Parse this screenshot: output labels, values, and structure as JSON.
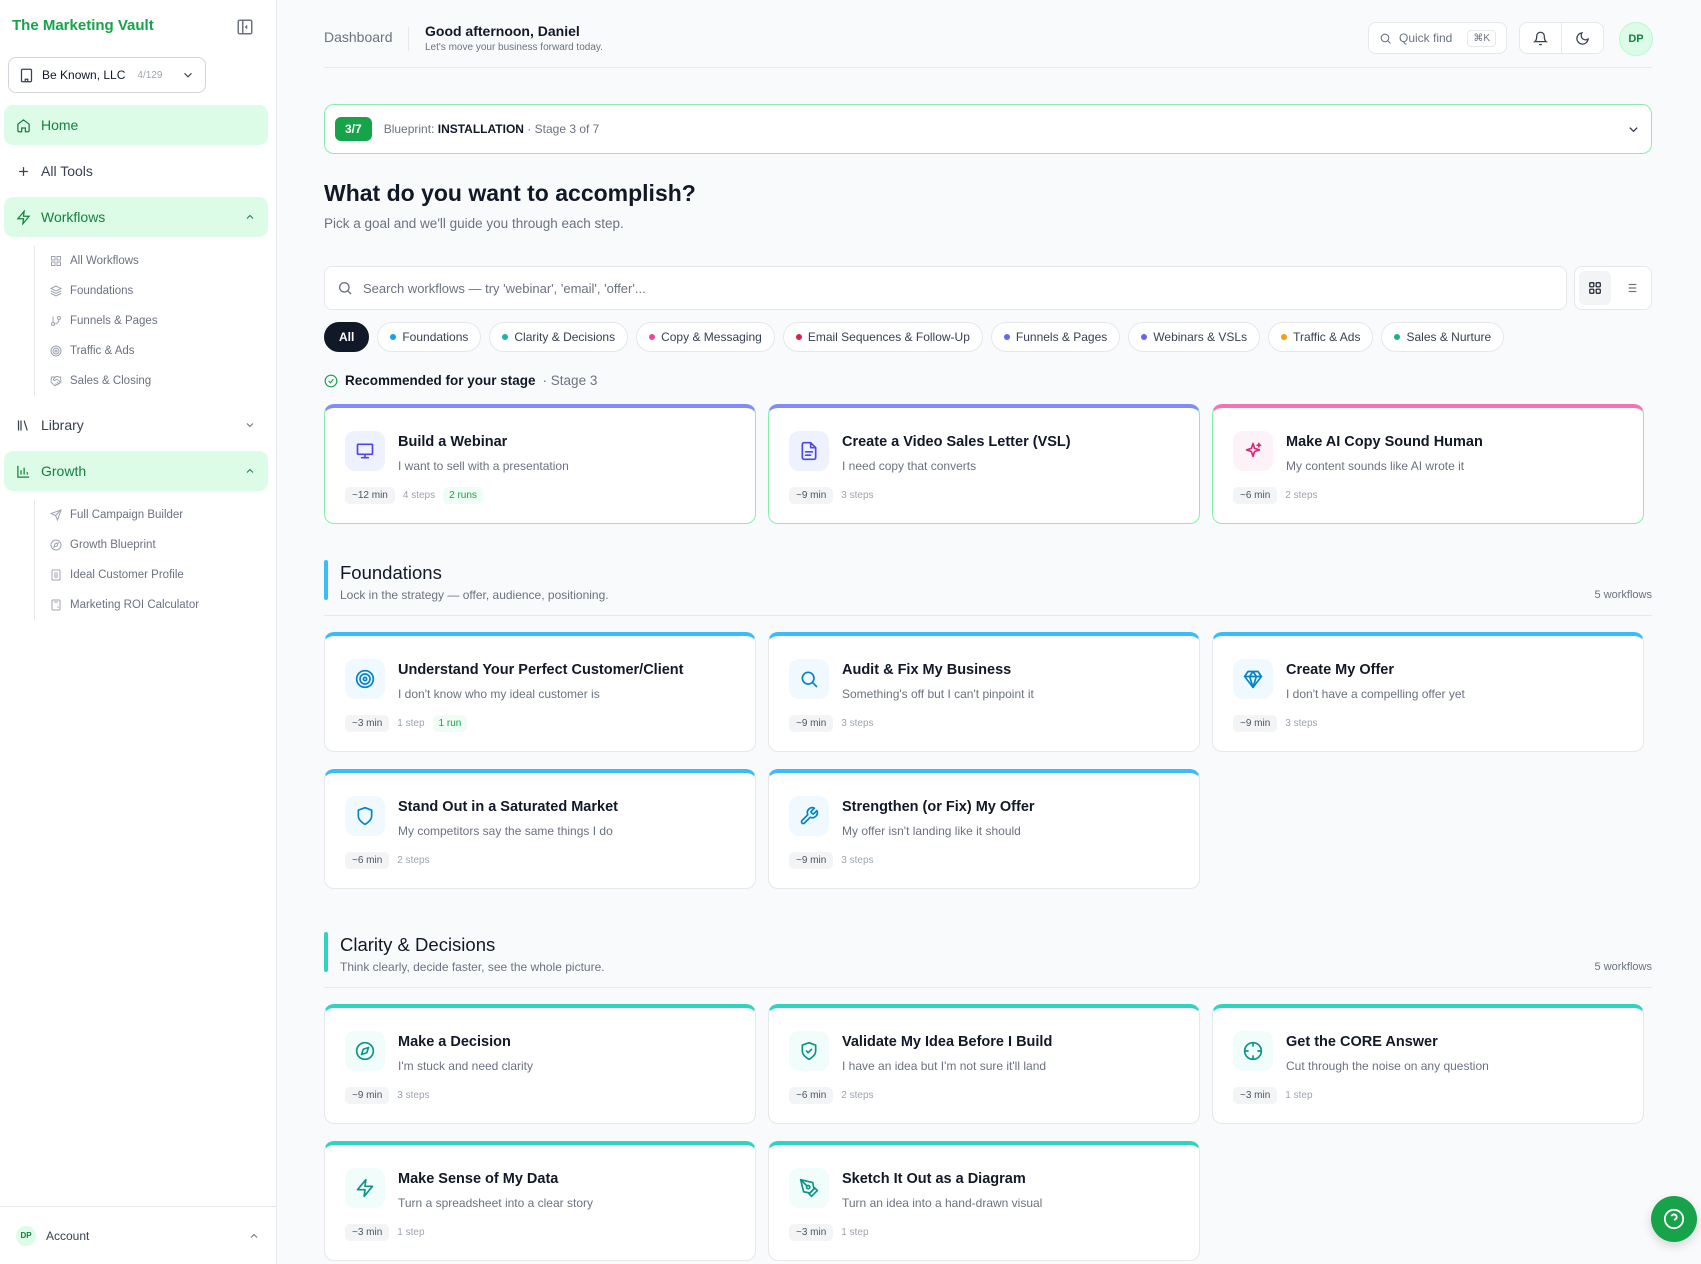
{
  "sidebar": {
    "brand": "The Marketing Vault",
    "org": {
      "name": "Be Known, LLC",
      "count": "4/129"
    },
    "nav": {
      "home": "Home",
      "all_tools": "All Tools",
      "workflows": "Workflows",
      "library": "Library",
      "growth": "Growth"
    },
    "workflow_items": [
      "All Workflows",
      "Foundations",
      "Funnels & Pages",
      "Traffic & Ads",
      "Sales & Closing"
    ],
    "growth_items": [
      "Full Campaign Builder",
      "Growth Blueprint",
      "Ideal Customer Profile",
      "Marketing ROI Calculator"
    ],
    "account": {
      "initials": "DP",
      "label": "Account"
    }
  },
  "header": {
    "breadcrumb": "Dashboard",
    "greeting": "Good afternoon, Daniel",
    "greeting_sub": "Let's move your business forward today.",
    "quick_find": "Quick find",
    "shortcut": "⌘K",
    "avatar": "DP"
  },
  "blueprint": {
    "badge": "3/7",
    "label": "Blueprint:",
    "stage_name": "INSTALLATION",
    "stage_text": "· Stage 3 of 7"
  },
  "main": {
    "title": "What do you want to accomplish?",
    "subtitle": "Pick a goal and we'll guide you through each step.",
    "search_placeholder": "Search workflows — try 'webinar', 'email', 'offer'..."
  },
  "filters": [
    {
      "label": "All"
    },
    {
      "label": "Foundations",
      "color": "#0ea5e9"
    },
    {
      "label": "Clarity & Decisions",
      "color": "#14b8a6"
    },
    {
      "label": "Copy & Messaging",
      "color": "#ec4899"
    },
    {
      "label": "Email Sequences & Follow-Up",
      "color": "#e11d48"
    },
    {
      "label": "Funnels & Pages",
      "color": "#6366f1"
    },
    {
      "label": "Webinars & VSLs",
      "color": "#6366f1"
    },
    {
      "label": "Traffic & Ads",
      "color": "#f59e0b"
    },
    {
      "label": "Sales & Nurture",
      "color": "#10b981"
    }
  ],
  "recommended": {
    "title": "Recommended for your stage",
    "stage": "· Stage 3",
    "cards": [
      {
        "title": "Build a Webinar",
        "desc": "I want to sell with a presentation",
        "time": "~12 min",
        "steps": "4 steps",
        "runs": "2 runs",
        "icon": "presentation-icon",
        "accent": "#818cf8"
      },
      {
        "title": "Create a Video Sales Letter (VSL)",
        "desc": "I need copy that converts",
        "time": "~9 min",
        "steps": "3 steps",
        "icon": "document-icon",
        "accent": "#818cf8"
      },
      {
        "title": "Make AI Copy Sound Human",
        "desc": "My content sounds like AI wrote it",
        "time": "~6 min",
        "steps": "2 steps",
        "icon": "sparkle-icon",
        "accent": "#f472b6"
      }
    ]
  },
  "foundations": {
    "title": "Foundations",
    "subtitle": "Lock in the strategy — offer, audience, positioning.",
    "count": "5 workflows",
    "accent": "#38bdf8",
    "cards": [
      {
        "title": "Understand Your Perfect Customer/Client",
        "desc": "I don't know who my ideal customer is",
        "time": "~3 min",
        "steps": "1 step",
        "runs": "1 run",
        "icon": "target-icon"
      },
      {
        "title": "Audit & Fix My Business",
        "desc": "Something's off but I can't pinpoint it",
        "time": "~9 min",
        "steps": "3 steps",
        "icon": "search-icon"
      },
      {
        "title": "Create My Offer",
        "desc": "I don't have a compelling offer yet",
        "time": "~9 min",
        "steps": "3 steps",
        "icon": "diamond-icon"
      },
      {
        "title": "Stand Out in a Saturated Market",
        "desc": "My competitors say the same things I do",
        "time": "~6 min",
        "steps": "2 steps",
        "icon": "shield-icon"
      },
      {
        "title": "Strengthen (or Fix) My Offer",
        "desc": "My offer isn't landing like it should",
        "time": "~9 min",
        "steps": "3 steps",
        "icon": "wrench-icon"
      }
    ]
  },
  "clarity": {
    "title": "Clarity & Decisions",
    "subtitle": "Think clearly, decide faster, see the whole picture.",
    "count": "5 workflows",
    "accent": "#2dd4bf",
    "cards": [
      {
        "title": "Make a Decision",
        "desc": "I'm stuck and need clarity",
        "time": "~9 min",
        "steps": "3 steps",
        "icon": "compass-icon"
      },
      {
        "title": "Validate My Idea Before I Build",
        "desc": "I have an idea but I'm not sure it'll land",
        "time": "~6 min",
        "steps": "2 steps",
        "icon": "shield-check-icon"
      },
      {
        "title": "Get the CORE Answer",
        "desc": "Cut through the noise on any question",
        "time": "~3 min",
        "steps": "1 step",
        "icon": "crosshair-icon"
      },
      {
        "title": "Make Sense of My Data",
        "desc": "Turn a spreadsheet into a clear story",
        "time": "~3 min",
        "steps": "1 step",
        "icon": "bolt-icon"
      },
      {
        "title": "Sketch It Out as a Diagram",
        "desc": "Turn an idea into a hand-drawn visual",
        "time": "~3 min",
        "steps": "1 step",
        "icon": "pen-tool-icon"
      }
    ]
  }
}
